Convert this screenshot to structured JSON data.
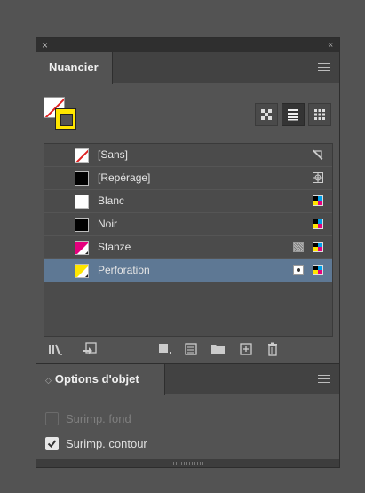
{
  "titlebar": {
    "close": "×",
    "collapse": "‹‹"
  },
  "swatches_panel": {
    "tab": "Nuancier",
    "swatches": [
      {
        "name": "[Sans]",
        "color": "#ffffff",
        "kind": "none",
        "right_icons": [
          "no-edit-icon"
        ]
      },
      {
        "name": "[Repérage]",
        "color": "#000000",
        "kind": "registration",
        "right_icons": [
          "registration-icon"
        ]
      },
      {
        "name": "Blanc",
        "color": "#ffffff",
        "kind": "process",
        "right_icons": [
          "cmyk-icon"
        ]
      },
      {
        "name": "Noir",
        "color": "#000000",
        "kind": "process",
        "right_icons": [
          "cmyk-icon"
        ]
      },
      {
        "name": "Stanze",
        "color": "#e5007d",
        "kind": "spot-tint",
        "right_icons": [
          "tint-icon",
          "cmyk-icon"
        ]
      },
      {
        "name": "Perforation",
        "color": "#ffe600",
        "kind": "spot",
        "selected": true,
        "right_icons": [
          "spot-icon",
          "cmyk-icon"
        ]
      }
    ],
    "colors": {
      "selection": "#5e7894",
      "fill_stroke_yellow": "#ffe600",
      "none_red": "#e02020"
    }
  },
  "object_options_panel": {
    "tab": "Options d'objet",
    "diamond": "◇",
    "overprint_fill": {
      "label": "Surimp. fond",
      "checked": false,
      "disabled": true
    },
    "overprint_stroke": {
      "label": "Surimp. contour",
      "checked": true,
      "disabled": false
    }
  }
}
